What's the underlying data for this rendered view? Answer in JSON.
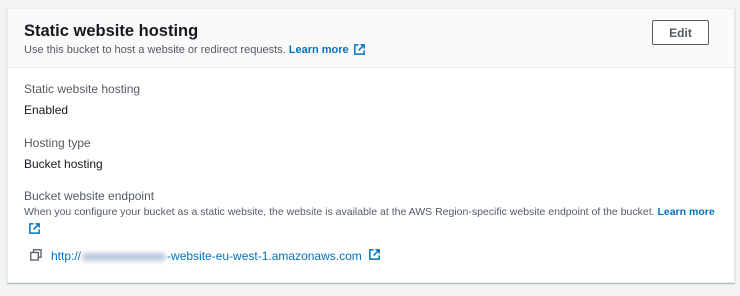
{
  "header": {
    "title": "Static website hosting",
    "description": "Use this bucket to host a website or redirect requests.",
    "learn_more": "Learn more",
    "edit_label": "Edit"
  },
  "fields": {
    "hosting_label": "Static website hosting",
    "hosting_value": "Enabled",
    "type_label": "Hosting type",
    "type_value": "Bucket hosting",
    "endpoint_label": "Bucket website endpoint",
    "endpoint_description": "When you configure your bucket as a static website, the website is available at the AWS Region-specific website endpoint of the bucket.",
    "endpoint_learn_more": "Learn more",
    "endpoint_url_prefix": "http://",
    "endpoint_url_suffix": "-website-eu-west-1.amazonaws.com"
  },
  "colors": {
    "link": "#0073bb",
    "text": "#16191f",
    "muted": "#545b64"
  },
  "icons": [
    "external-link-icon",
    "copy-icon"
  ]
}
